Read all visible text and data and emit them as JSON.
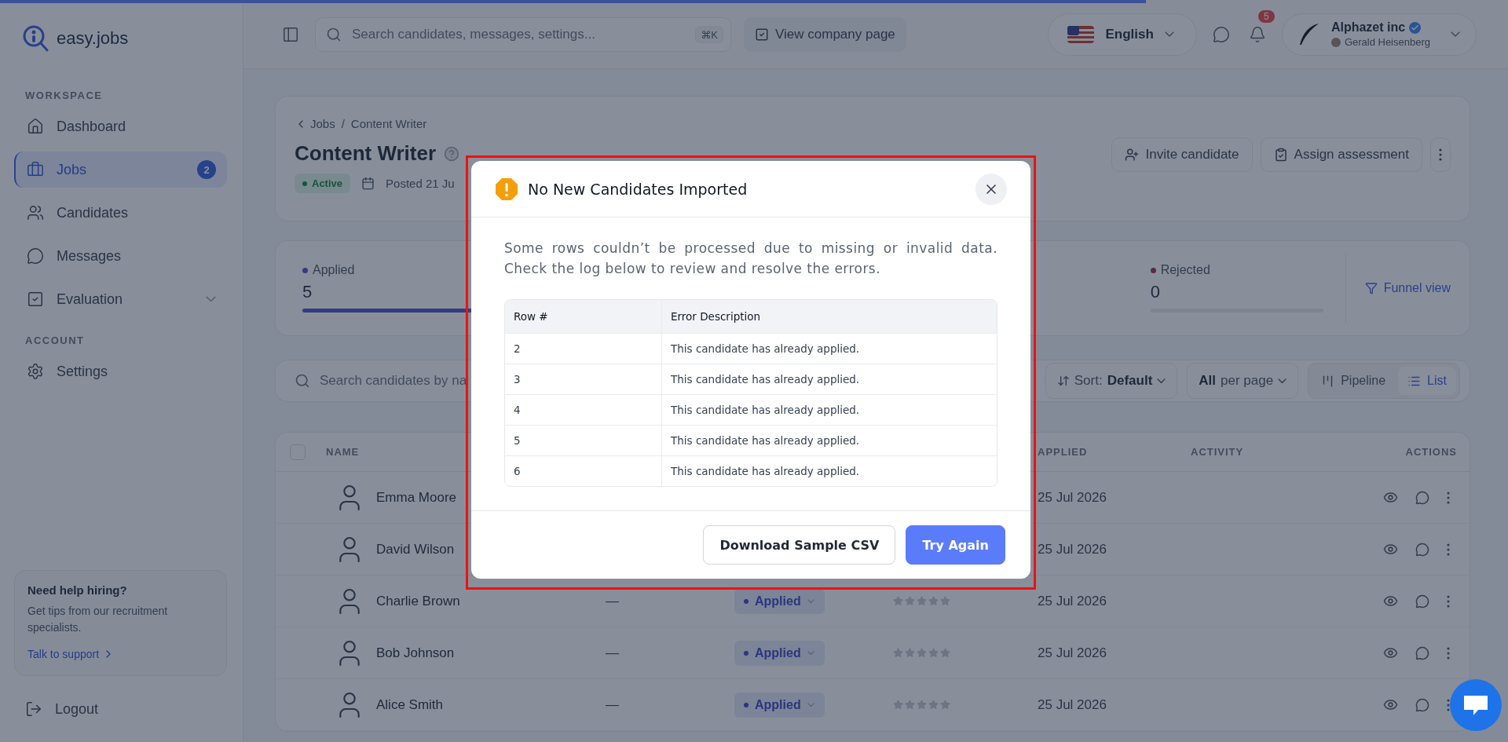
{
  "top_progress": {
    "level": 0.76
  },
  "sidebar": {
    "logo": "easy.jobs",
    "sections": [
      {
        "heading": "WORKSPACE",
        "items": [
          {
            "label": "Dashboard",
            "selected": false,
            "has_submenu": false
          },
          {
            "label": "Jobs",
            "selected": true,
            "badge": "2",
            "has_submenu": false
          },
          {
            "label": "Candidates",
            "selected": false,
            "has_submenu": false
          },
          {
            "label": "Messages",
            "selected": false,
            "has_submenu": false
          },
          {
            "label": "Evaluation",
            "selected": false,
            "has_submenu": true
          }
        ]
      },
      {
        "heading": "ACCOUNT",
        "items": [
          {
            "label": "Settings",
            "selected": false,
            "has_submenu": false
          }
        ]
      }
    ],
    "help_card": {
      "title": "Need help hiring?",
      "text": "Get tips from our recruitment specialists.",
      "link": "Talk to support"
    },
    "logout": "Logout"
  },
  "topbar": {
    "search": {
      "placeholder": "Search candidates, messages, settings...",
      "shortcut": "⌘K"
    },
    "company_button": "View company page",
    "language": "English",
    "notifications": "5",
    "account": {
      "company": "Alphazet inc",
      "user": "Gerald Heisenberg"
    }
  },
  "job": {
    "breadcrumb": [
      "Jobs",
      "Content Writer"
    ],
    "breadcrumb_separator": "/",
    "title": "Content Writer",
    "status": "Active",
    "posted": "Posted 21 Ju",
    "actions": [
      "Invite candidate",
      "Assign assessment"
    ]
  },
  "stages": [
    {
      "label": "Applied",
      "count": "5",
      "level": 1
    },
    {
      "label": "Rejected",
      "count": "0",
      "level": 0
    }
  ],
  "funnel_link": "Funnel view",
  "toolbar": {
    "search_placeholder": "Search candidates by na",
    "sort_label": "Sort:",
    "sort_value": "Default",
    "per_page_value": "All",
    "per_page_label": "per page",
    "views": [
      {
        "label": "Pipeline",
        "selected": false
      },
      {
        "label": "List",
        "selected": true
      }
    ]
  },
  "table": {
    "select_all": {
      "checked": false
    },
    "columns": [
      "NAME",
      "APPLIED",
      "ACTIVITY",
      "ACTIONS"
    ],
    "rows": [
      {
        "name": "Emma Moore",
        "applied": "25 Jul 2026"
      },
      {
        "name": "David Wilson",
        "applied": "25 Jul 2026"
      },
      {
        "name": "Charlie Brown",
        "column_2": "—",
        "status": "Applied",
        "stars": 0,
        "applied": "25 Jul 2026"
      },
      {
        "name": "Bob Johnson",
        "column_2": "—",
        "status": "Applied",
        "stars": 0,
        "applied": "25 Jul 2026"
      },
      {
        "name": "Alice Smith",
        "column_2": "—",
        "status": "Applied",
        "stars": 0,
        "applied": "25 Jul 2026"
      }
    ]
  },
  "modal": {
    "title": "No New Candidates Imported",
    "message": "Some rows couldn’t be processed due to missing or invalid data. Check the log below to review and resolve the errors.",
    "log": {
      "columns": [
        "Row #",
        "Error Description"
      ],
      "rows": [
        [
          "2",
          "This candidate has already applied."
        ],
        [
          "3",
          "This candidate has already applied."
        ],
        [
          "4",
          "This candidate has already applied."
        ],
        [
          "5",
          "This candidate has already applied."
        ],
        [
          "6",
          "This candidate has already applied."
        ]
      ]
    },
    "buttons": [
      {
        "label": "Download Sample CSV",
        "kind": "secondary"
      },
      {
        "label": "Try Again",
        "kind": "primary"
      }
    ]
  }
}
